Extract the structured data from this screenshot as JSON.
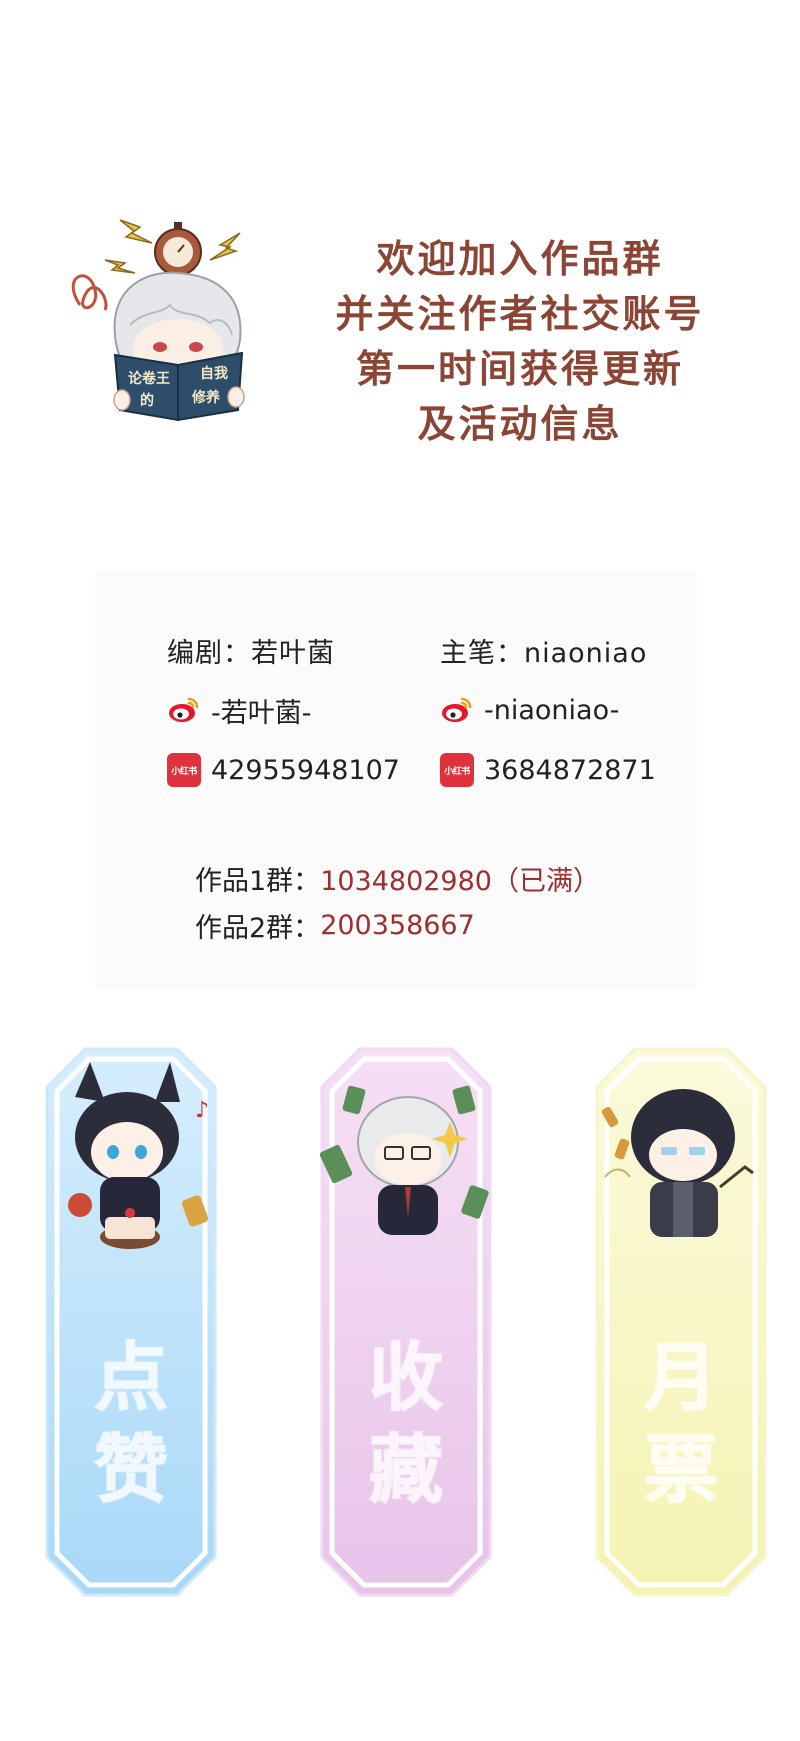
{
  "headline": {
    "lines": [
      "欢迎加入作品群",
      "并关注作者社交账号",
      "第一时间获得更新",
      "及活动信息"
    ]
  },
  "mascot": {
    "book_text": [
      "论卷王",
      "的",
      "自我",
      "修养"
    ]
  },
  "credits": {
    "writer": {
      "role": "编剧：若叶菌",
      "weibo": "-若叶菌-",
      "xiaohongshu": "42955948107"
    },
    "artist": {
      "role": "主笔：niaoniao",
      "weibo": "-niaoniao-",
      "xiaohongshu": "3684872871"
    },
    "xhs_badge_text": "小红书"
  },
  "groups": [
    {
      "label": "作品1群：",
      "value": "1034802980（已满）"
    },
    {
      "label": "作品2群：",
      "value": "200358667"
    }
  ],
  "actions": [
    {
      "line1": "点",
      "line2": "赞",
      "color": "#bfe2fb"
    },
    {
      "line1": "收",
      "line2": "藏",
      "color": "#f0d4ef"
    },
    {
      "line1": "月",
      "line2": "票",
      "color": "#f9f7c4"
    }
  ],
  "colors": {
    "headline": "#8b4535",
    "group_number": "#9c2f2f",
    "xhs_red": "#e0323d",
    "weibo_red": "#e6162d"
  }
}
